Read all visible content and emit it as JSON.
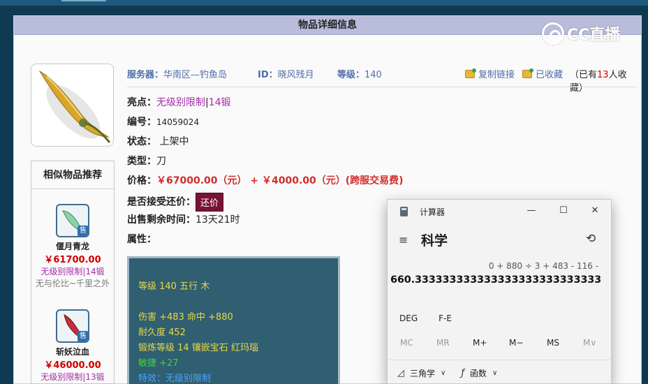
{
  "page_title": "物品详细信息",
  "watermark": "CC直播",
  "item": {
    "server_label": "服务器：",
    "server_value": "华南区—钓鱼岛",
    "id_label": "ID：",
    "id_value": "晓风残月",
    "level_label": "等级：",
    "level_value": "140",
    "copy_link": "复制链接",
    "favorited": "已收藏",
    "fav_count_prefix": "（已有",
    "fav_count": "13",
    "fav_count_suffix": "人收藏）",
    "highlight_label": "亮点：",
    "highlight_a": "无级别限制",
    "highlight_sep": "|",
    "highlight_b": "14锻",
    "serial_label": "编号：",
    "serial_value": "14059024",
    "status_label": "状态：",
    "status_value": " 上架中",
    "type_label": "类型：",
    "type_value": "刀",
    "price_label": "价格：",
    "price_value": "￥67000.00（元） + ￥4000.00（元）(跨服交易费)",
    "counter_label": "是否接受还价：",
    "counter_button": "还价",
    "remaining_label": "出售剩余时间：",
    "remaining_value": "13天21时",
    "attr_label": "属性："
  },
  "attributes": {
    "line1": "等级 140 五行 木",
    "line2": "伤害 +483 命中 +880",
    "line3": "耐久度 452",
    "line4": "锻炼等级 14 镶嵌宝石 红玛瑙",
    "line5": "敏捷 +27",
    "line6": "特效：无级别限制"
  },
  "similar": {
    "title": "相似物品推荐",
    "badge": "售",
    "items": [
      {
        "name": "偃月青龙",
        "price": "￥61700.00",
        "tag": "无级别限制|14锻",
        "desc": "无与伦比~千里之外"
      },
      {
        "name": "斩妖泣血",
        "price": "￥46000.00",
        "tag": "无级别限制|13锻"
      }
    ]
  },
  "calculator": {
    "title": "计算器",
    "mode": "科学",
    "expression": "0 + 880 ÷ 3 + 483 - 116 -",
    "result": "660.333333333333333333333333333",
    "row1": [
      "DEG",
      "F-E"
    ],
    "memory": [
      "MC",
      "MR",
      "M+",
      "M−",
      "MS",
      "M∨"
    ],
    "trig": "三角学",
    "func": "函数",
    "minimize": "—",
    "maximize": "☐",
    "close": "✕",
    "menu_icon": "≡",
    "history_icon": "⟲",
    "chevron": "∨"
  }
}
